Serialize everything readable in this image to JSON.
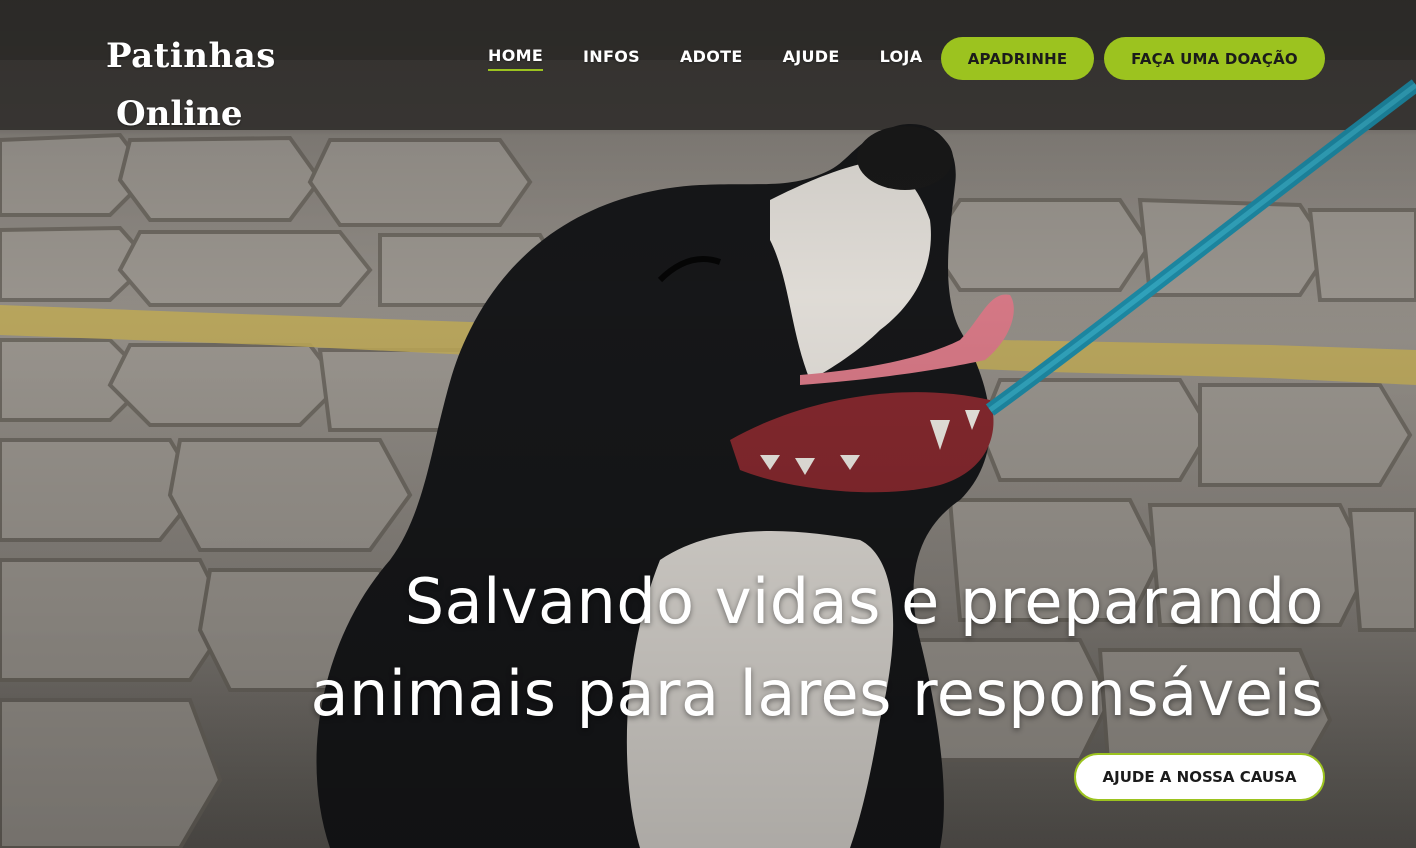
{
  "brand": {
    "name_line1": "Patinhas",
    "name_line2": "Online"
  },
  "nav": {
    "items": [
      {
        "label": "HOME",
        "active": true
      },
      {
        "label": "INFOS",
        "active": false
      },
      {
        "label": "ADOTE",
        "active": false
      },
      {
        "label": "AJUDE",
        "active": false
      },
      {
        "label": "LOJA",
        "active": false
      }
    ]
  },
  "actions": {
    "sponsor_label": "APADRINHE",
    "donate_label": "FAÇA UMA DOAÇÃO"
  },
  "hero": {
    "headline_line1": "Salvando vidas e preparando",
    "headline_line2": "animais para lares responsáveis",
    "cta_label": "AJUDE A NOSSA CAUSA",
    "image": "dog-on-leash-photo"
  },
  "colors": {
    "accent": "#9cc31f",
    "text_light": "#ffffff",
    "text_dark": "#1b1b1b"
  }
}
